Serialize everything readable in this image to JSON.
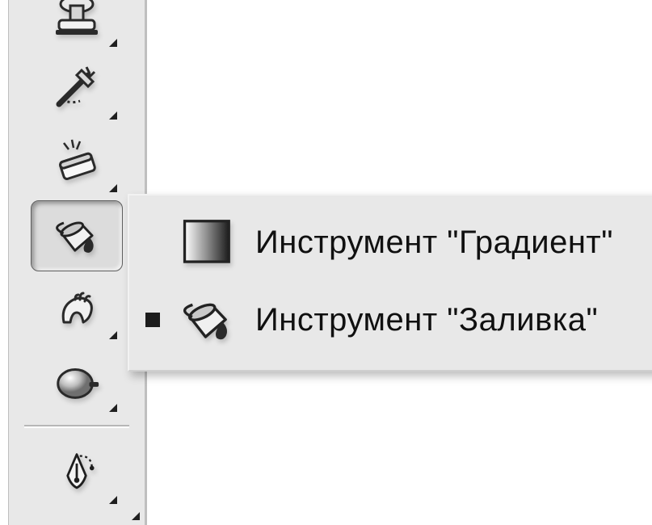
{
  "toolbar": {
    "tools": [
      {
        "name": "stamp-tool"
      },
      {
        "name": "healing-brush-tool"
      },
      {
        "name": "eraser-tool"
      },
      {
        "name": "paint-bucket-tool",
        "selected": true
      },
      {
        "name": "smudge-tool"
      },
      {
        "name": "dodge-tool"
      },
      {
        "name": "pen-tool"
      }
    ]
  },
  "flyout": {
    "items": [
      {
        "id": "gradient",
        "label": "Инструмент \"Градиент\"",
        "active": false
      },
      {
        "id": "bucket",
        "label": "Инструмент \"Заливка\"",
        "active": true
      }
    ]
  }
}
